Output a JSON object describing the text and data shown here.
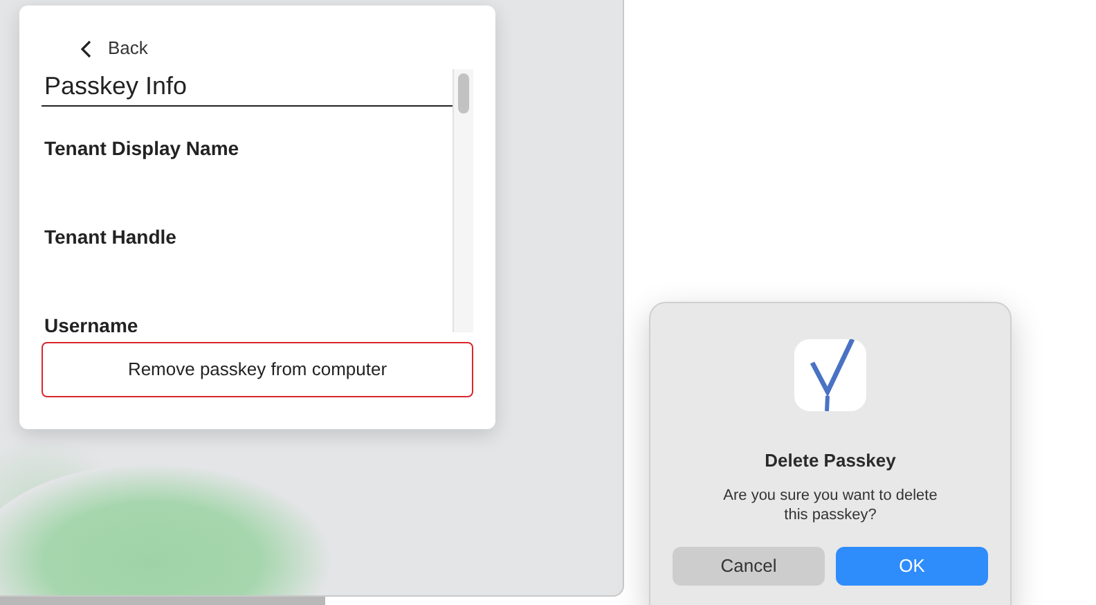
{
  "info_panel": {
    "back_label": "Back",
    "title": "Passkey Info",
    "fields": [
      {
        "label": "Tenant Display Name"
      },
      {
        "label": "Tenant Handle"
      },
      {
        "label": "Username"
      }
    ],
    "remove_button": "Remove passkey from computer"
  },
  "dialog": {
    "title": "Delete Passkey",
    "message": "Are you sure you want to delete this passkey?",
    "buttons": [
      {
        "label": "Cancel",
        "kind": "secondary"
      },
      {
        "label": "OK",
        "kind": "primary"
      }
    ]
  }
}
